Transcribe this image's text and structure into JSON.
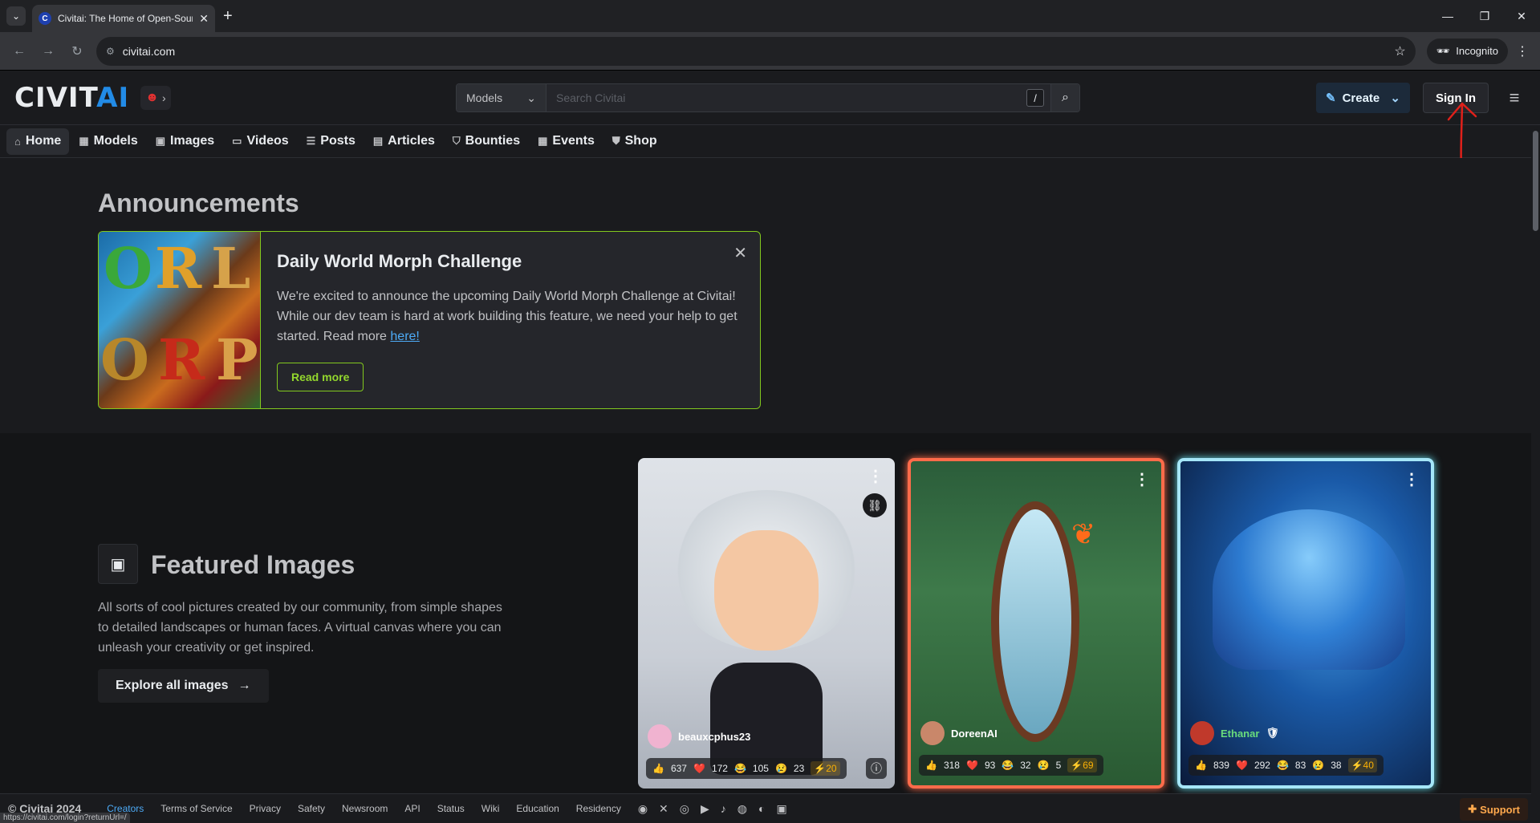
{
  "browser": {
    "tab_title": "Civitai: The Home of Open-Source Generative AI",
    "tab_favicon": "C",
    "url": "civitai.com",
    "incognito_label": "Incognito",
    "status_url": "https://civitai.com/login?returnUrl=/"
  },
  "header": {
    "logo_main": "CIVIT",
    "logo_accent": "AI",
    "search_category": "Models",
    "search_placeholder": "Search Civitai",
    "slash_key": "/",
    "create_label": "Create",
    "signin_label": "Sign In"
  },
  "nav": {
    "items": [
      {
        "label": "Home",
        "icon": "home-icon"
      },
      {
        "label": "Models",
        "icon": "grid-icon"
      },
      {
        "label": "Images",
        "icon": "image-icon"
      },
      {
        "label": "Videos",
        "icon": "video-icon"
      },
      {
        "label": "Posts",
        "icon": "posts-icon"
      },
      {
        "label": "Articles",
        "icon": "article-icon"
      },
      {
        "label": "Bounties",
        "icon": "bounty-icon"
      },
      {
        "label": "Events",
        "icon": "calendar-icon"
      },
      {
        "label": "Shop",
        "icon": "shop-icon"
      }
    ]
  },
  "announcements": {
    "title": "Announcements",
    "card": {
      "heading": "Daily World Morph Challenge",
      "text_before_link": "We're excited to announce the upcoming Daily World Morph Challenge at Civitai! While our dev team is hard at work building this feature, we need your help to get started. Read more ",
      "link_text": "here!",
      "button_label": "Read more",
      "image_letters": "ORL ORP"
    }
  },
  "featured": {
    "title": "Featured Images",
    "description": "All sorts of cool pictures created by our community, from simple shapes to detailed landscapes or human faces. A virtual canvas where you can unleash your creativity or get inspired.",
    "button_label": "Explore all images",
    "cards": [
      {
        "user": "beauxcphus23",
        "likes": "637",
        "hearts": "172",
        "laughs": "105",
        "cries": "23",
        "buzz": "20"
      },
      {
        "user": "DoreenAI",
        "likes": "318",
        "hearts": "93",
        "laughs": "32",
        "cries": "5",
        "buzz": "69"
      },
      {
        "user": "Ethanar",
        "likes": "839",
        "hearts": "292",
        "laughs": "83",
        "cries": "38",
        "buzz": "40"
      }
    ]
  },
  "footer": {
    "copyright": "© Civitai 2024",
    "links": [
      "Creators",
      "Terms of Service",
      "Privacy",
      "Safety",
      "Newsroom",
      "API",
      "Status",
      "Wiki",
      "Education",
      "Residency"
    ],
    "support_label": "Support"
  },
  "colors": {
    "accent_green": "#82c91e",
    "signin_arrow": "#e0201a",
    "link_blue": "#4dabf7",
    "card2_border": "#ff6b4a",
    "card3_border": "#a5e6f8"
  }
}
